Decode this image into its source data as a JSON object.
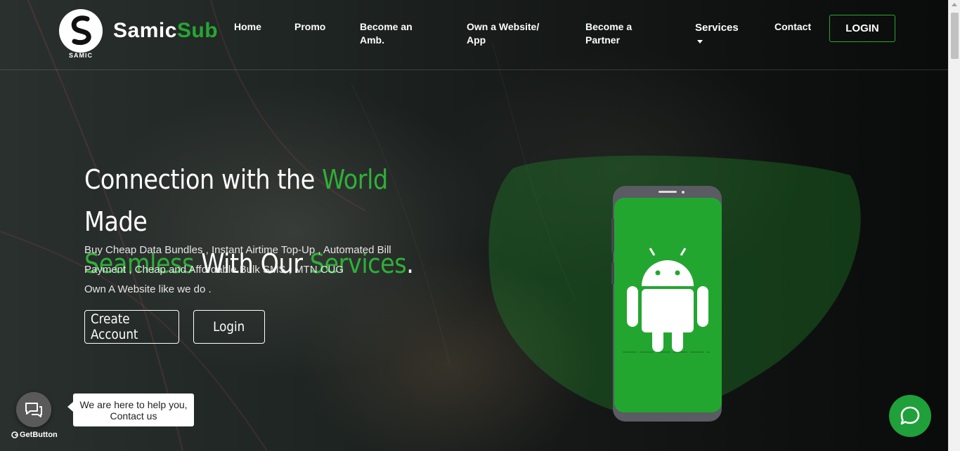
{
  "brand": {
    "mark_caption": "SAMIC",
    "name_part1": "Samic",
    "name_part2": "Sub",
    "accent_color": "#27a732"
  },
  "nav": {
    "items": [
      {
        "label": "Home"
      },
      {
        "label": "Promo"
      },
      {
        "label": "Become an Amb."
      },
      {
        "label": "Own a Website/ App"
      },
      {
        "label": "Become a Partner"
      },
      {
        "label": "Services"
      },
      {
        "label": "Contact"
      }
    ],
    "login_label": "LOGIN"
  },
  "hero": {
    "title_parts": [
      "Connection with the ",
      "World",
      " Made ",
      "Seamless",
      " With Our ",
      "Services",
      "."
    ],
    "description": "Buy Cheap Data Bundles , Instant Airtime Top-Up , Automated Bill Payment , Cheap and Affordable Bulk SMS , MTN CUG",
    "description_line2": "Own A Website like we do .",
    "create_account_label": "Create Account",
    "login_label": "Login"
  },
  "illustration": {
    "icon": "android-phone-icon",
    "screen_color": "#23a630"
  },
  "widgets": {
    "help_text": "We are here to help you, Contact us",
    "getbutton_label": "GetButton",
    "chat_icon": "chat-icon"
  }
}
